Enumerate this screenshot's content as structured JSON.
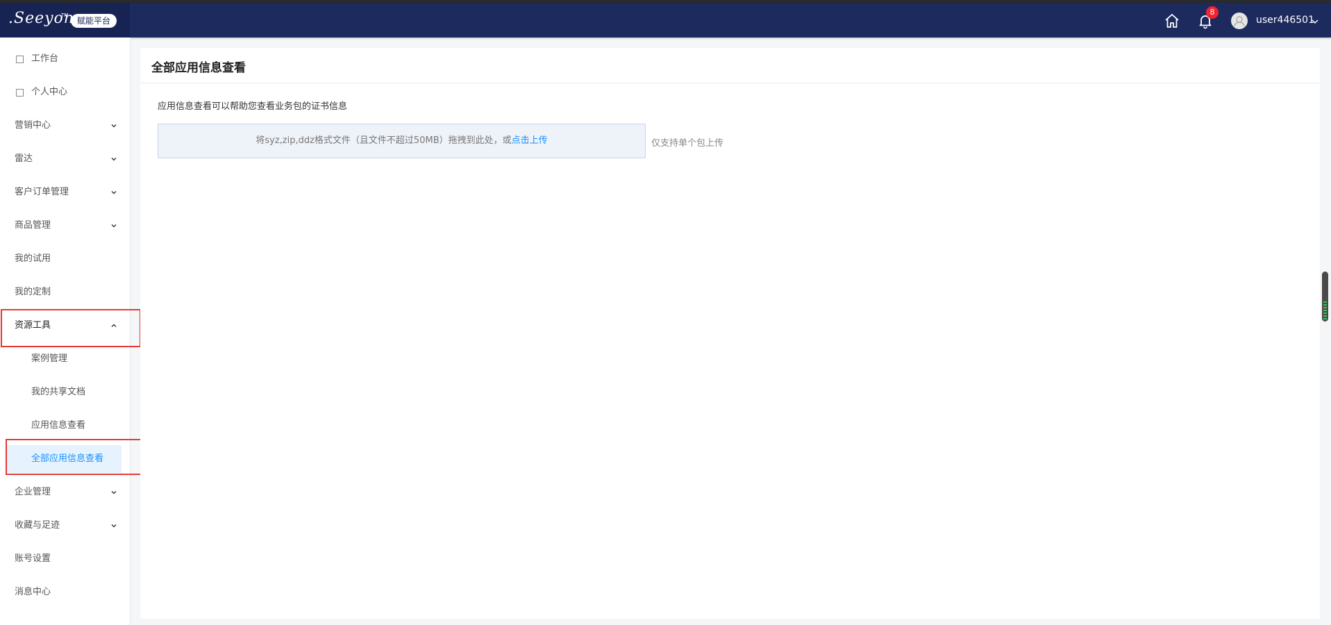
{
  "header": {
    "logo_text": ".Seeyon",
    "logo_tm": "TM",
    "platform_badge": "赋能平台",
    "notification_count": "8",
    "username": "user446501",
    "icons": [
      "home-icon",
      "bell-icon",
      "user-avatar-icon",
      "chevron-down-icon"
    ]
  },
  "sidebar": {
    "items": [
      {
        "label": "工作台",
        "icon": "page-icon"
      },
      {
        "label": "个人中心",
        "icon": "page-icon"
      },
      {
        "label": "营销中心",
        "expandable": true
      },
      {
        "label": "雷达",
        "expandable": true
      },
      {
        "label": "客户订单管理",
        "expandable": true
      },
      {
        "label": "商品管理",
        "expandable": true
      },
      {
        "label": "我的试用"
      },
      {
        "label": "我的定制"
      },
      {
        "label": "资源工具",
        "expandable": true,
        "expanded": true
      },
      {
        "label": "案例管理",
        "sub": true
      },
      {
        "label": "我的共享文档",
        "sub": true
      },
      {
        "label": "应用信息查看",
        "sub": true
      },
      {
        "label": "全部应用信息查看",
        "sub": true,
        "active": true
      },
      {
        "label": "企业管理",
        "expandable": true
      },
      {
        "label": "收藏与足迹",
        "expandable": true
      },
      {
        "label": "账号设置"
      },
      {
        "label": "消息中心"
      }
    ]
  },
  "main": {
    "title": "全部应用信息查看",
    "description": "应用信息查看可以帮助您查看业务包的证书信息",
    "upload": {
      "prompt": "将syz,zip,ddz格式文件（且文件不超过50MB）拖拽到此处，或",
      "link": "点击上传",
      "hint": "仅支持单个包上传"
    }
  },
  "colors": {
    "header_bg": "#1c2a5e",
    "active_text": "#1890ff",
    "highlight_box": "#e53935"
  }
}
